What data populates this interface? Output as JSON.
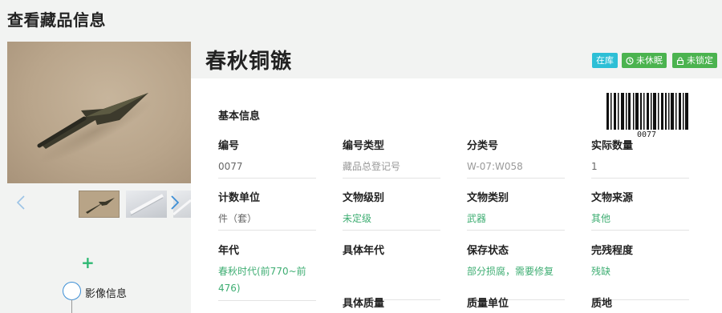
{
  "page": {
    "title": "查看藏品信息"
  },
  "gallery": {
    "prev_icon": "chevron-left-icon",
    "next_icon": "chevron-right-icon",
    "thumbnails": [
      "thumbnail-bronze-arrowhead",
      "thumbnail-gray-object",
      "thumbnail-partial"
    ]
  },
  "sidebar": {
    "add_icon": "plus-icon",
    "add_symbol": "+",
    "timeline_label": "影像信息"
  },
  "relic": {
    "name": "春秋铜镞",
    "badges": {
      "status": "在库",
      "sleep": "未休眠",
      "lock": "未锁定"
    },
    "barcode_number": "0077"
  },
  "basic_info": {
    "section_title": "基本信息",
    "fields": [
      {
        "label": "编号",
        "value": "0077"
      },
      {
        "label": "编号类型",
        "value": "藏品总登记号"
      },
      {
        "label": "分类号",
        "value": "W-07:W058"
      },
      {
        "label": "实际数量",
        "value": "1"
      },
      {
        "label": "计数单位",
        "value": "件（套）"
      },
      {
        "label": "文物级别",
        "value": "未定级"
      },
      {
        "label": "文物类别",
        "value": "武器"
      },
      {
        "label": "文物来源",
        "value": "其他"
      },
      {
        "label": "年代",
        "value": "春秋时代(前770~前476)"
      },
      {
        "label": "具体年代",
        "value": ""
      },
      {
        "label": "保存状态",
        "value": "部分损腐，需要修复"
      },
      {
        "label": "完残程度",
        "value": "残缺"
      },
      {
        "label": "具体质量",
        "value": ""
      },
      {
        "label": "质量单位",
        "value": ""
      },
      {
        "label": "质地",
        "value": ""
      }
    ]
  },
  "colors": {
    "accent_blue": "#3d8fd6",
    "status_cyan": "#2dbfd6",
    "status_green": "#4bb34f",
    "value_green": "#3fae73"
  }
}
